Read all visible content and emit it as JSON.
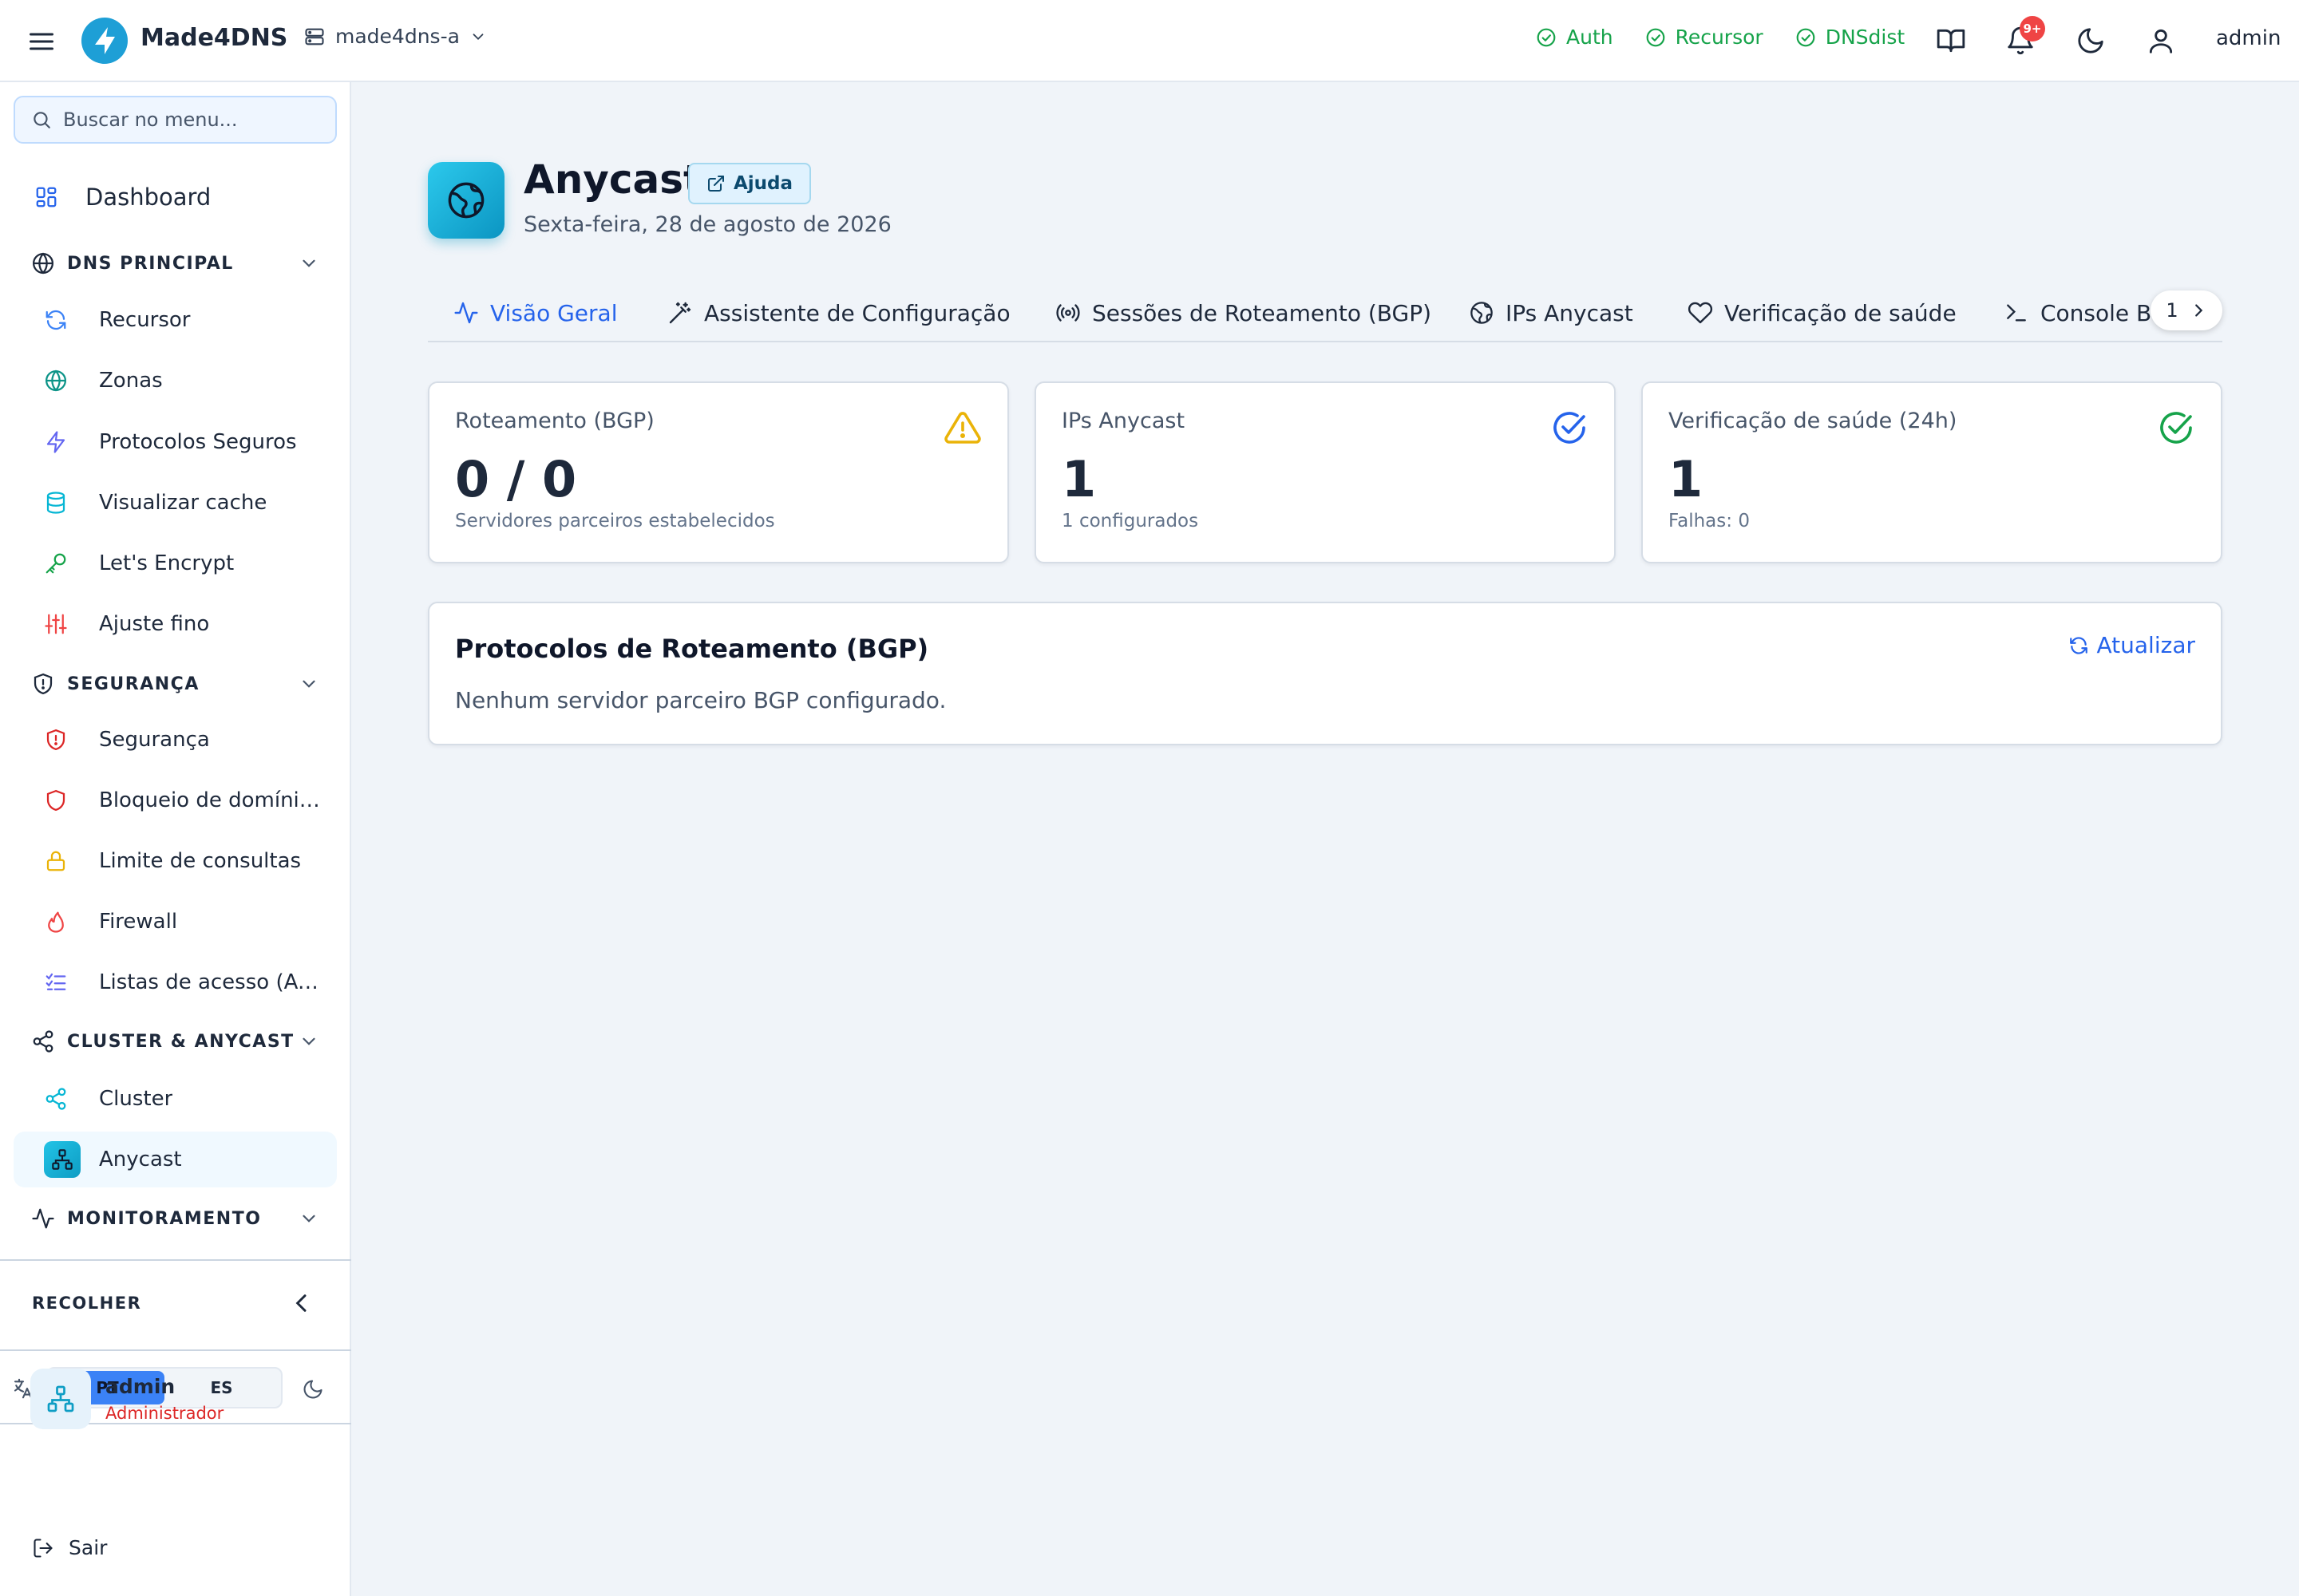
{
  "app": {
    "brand": "Made4DNS",
    "server": "made4dns-a",
    "user": "admin"
  },
  "status": [
    {
      "label": "Auth"
    },
    {
      "label": "Recursor"
    },
    {
      "label": "DNSdist"
    }
  ],
  "notifications": {
    "badge": "9+"
  },
  "sidebar": {
    "search_placeholder": "Buscar no menu...",
    "dashboard": "Dashboard",
    "sections": {
      "dns": "DNS PRINCIPAL",
      "security": "SEGURANÇA",
      "cluster": "CLUSTER & ANYCAST",
      "monitoring": "MONITORAMENTO"
    },
    "dns_items": [
      "Recursor",
      "Zonas",
      "Protocolos Seguros",
      "Visualizar cache",
      "Let's Encrypt",
      "Ajuste fino"
    ],
    "security_items": [
      "Segurança",
      "Bloqueio de domínios",
      "Limite de consultas",
      "Firewall",
      "Listas de acesso (ACL)"
    ],
    "cluster_items": [
      "Cluster",
      "Anycast"
    ],
    "collapse": "RECOLHER",
    "languages": [
      "PT",
      "ES"
    ],
    "user": {
      "name": "admin",
      "role": "Administrador"
    },
    "logout": "Sair"
  },
  "page": {
    "title": "Anycast",
    "help": "Ajuda",
    "date": "Sexta-feira, 28 de agosto de 2026"
  },
  "tabs": [
    "Visão Geral",
    "Assistente de Configuração",
    "Sessões de Roteamento (BGP)",
    "IPs Anycast",
    "Verificação de saúde",
    "Console BGP"
  ],
  "tab_page": "1",
  "stats": [
    {
      "label": "Roteamento (BGP)",
      "value": "0 / 0",
      "sub": "Servidores parceiros estabelecidos",
      "color": "#eab308"
    },
    {
      "label": "IPs Anycast",
      "value": "1",
      "sub": "1 configurados",
      "color": "#2563eb"
    },
    {
      "label": "Verificação de saúde (24h)",
      "value": "1",
      "sub": "Falhas: 0",
      "color": "#16a34a"
    }
  ],
  "bgp": {
    "title": "Protocolos de Roteamento (BGP)",
    "refresh": "Atualizar",
    "empty": "Nenhum servidor parceiro BGP configurado."
  }
}
